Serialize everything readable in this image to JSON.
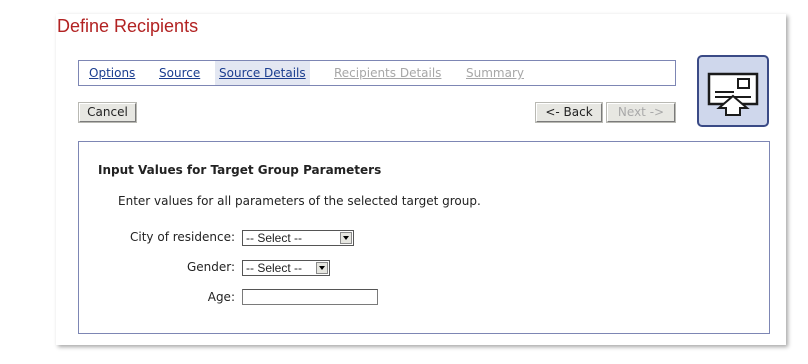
{
  "page": {
    "title": "Define Recipients"
  },
  "wizard_nav": {
    "steps": [
      {
        "label": "Options",
        "state": "active"
      },
      {
        "label": "Source",
        "state": "active"
      },
      {
        "label": "Source Details",
        "state": "current"
      },
      {
        "label": "Recipients Details",
        "state": "disabled"
      },
      {
        "label": "Summary",
        "state": "disabled"
      }
    ]
  },
  "toolbar": {
    "cancel_label": "Cancel",
    "back_label": "<- Back",
    "next_label": "Next ->",
    "next_enabled": false
  },
  "wizard_icon": {
    "name": "recipient-card-icon"
  },
  "parameters_panel": {
    "heading": "Input Values for Target Group Parameters",
    "description": "Enter values for all parameters of the selected target group.",
    "fields": [
      {
        "label": "City of residence:",
        "type": "select",
        "value": "-- Select --"
      },
      {
        "label": "Gender:",
        "type": "select",
        "value": "-- Select --"
      },
      {
        "label": "Age:",
        "type": "text",
        "value": ""
      }
    ]
  },
  "colors": {
    "title": "#b22222",
    "link": "#1a3d8f",
    "disabled_link": "#a7a7a7",
    "panel_border": "#7d86b4",
    "icon_background": "#cfd7ec"
  }
}
